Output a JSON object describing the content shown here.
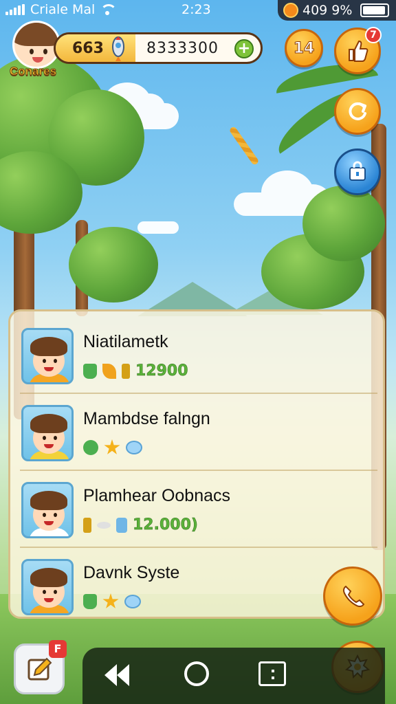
{
  "status_bar": {
    "carrier": "Criale Mal",
    "time": "2:23",
    "battery_text": "409 9%"
  },
  "player": {
    "name": "Conares",
    "level_value": "663",
    "currency": "8333300",
    "level_badge": "14",
    "notification_badge": "7"
  },
  "players_list": [
    {
      "name": "Niatilametk",
      "score": "12900",
      "icons": [
        "flask-icon",
        "leaf-icon",
        "bottle-icon"
      ],
      "shirt": "#f5a623"
    },
    {
      "name": "Mambdse falngn",
      "score": "",
      "icons": [
        "clover-icon",
        "star-icon",
        "gem-icon"
      ],
      "shirt": "#f2d23a"
    },
    {
      "name": "Plamhear Oobnacs",
      "score": "12.000)",
      "icons": [
        "bottle-icon",
        "wing-icon",
        "jar-icon"
      ],
      "shirt": "#ffffff"
    },
    {
      "name": "Davnk Syste",
      "score": "",
      "icons": [
        "flask-icon",
        "star-icon",
        "gem-icon"
      ],
      "shirt": "#f5a623"
    }
  ],
  "edit_badge": "F",
  "colors": {
    "accent_orange": "#f6a21b",
    "accent_blue": "#2a84d4",
    "score_green": "#5bb23a"
  }
}
